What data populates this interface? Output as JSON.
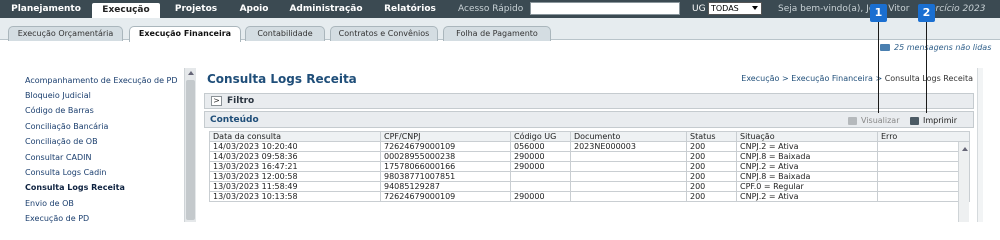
{
  "top_nav": {
    "tabs": [
      {
        "label": "Planejamento"
      },
      {
        "label": "Execução"
      },
      {
        "label": "Projetos"
      },
      {
        "label": "Apoio"
      },
      {
        "label": "Administração"
      },
      {
        "label": "Relatórios"
      }
    ],
    "acesso_rapido_label": "Acesso Rápido",
    "acesso_rapido_value": "",
    "ug_label": "UG",
    "ug_value": "TODAS",
    "welcome": "Seja bem-vindo(a), Joao Vitor",
    "exercicio": "Exercício 2023"
  },
  "sub_nav": {
    "tabs": [
      {
        "label": "Execução Orçamentária"
      },
      {
        "label": "Execução Financeira"
      },
      {
        "label": "Contabilidade"
      },
      {
        "label": "Contratos e Convênios"
      },
      {
        "label": "Folha de Pagamento"
      }
    ],
    "messages": "25 mensagens não lidas"
  },
  "sidebar": {
    "items": [
      {
        "label": "Acompanhamento de Execução de PD"
      },
      {
        "label": "Bloqueio Judicial"
      },
      {
        "label": "Código de Barras"
      },
      {
        "label": "Conciliação Bancária"
      },
      {
        "label": "Conciliação de OB"
      },
      {
        "label": "Consultar CADIN"
      },
      {
        "label": "Consulta Logs Cadin"
      },
      {
        "label": "Consulta Logs Receita"
      },
      {
        "label": "Envio de OB"
      },
      {
        "label": "Execução de PD"
      }
    ]
  },
  "main": {
    "title": "Consulta Logs Receita",
    "breadcrumb": {
      "first": "Execução",
      "sep1": ">",
      "second": "Execução Financeira",
      "sep2": ">",
      "current": "Consulta Logs Receita"
    },
    "filtro_label": "Filtro",
    "filtro_toggle": ">",
    "conteudo_label": "Conteúdo",
    "visualizar_label": "Visualizar",
    "imprimir_label": "Imprimir"
  },
  "table": {
    "columns": [
      "Data da consulta",
      "CPF/CNPJ",
      "Código UG",
      "Documento",
      "Status",
      "Situação",
      "Erro"
    ],
    "rows": [
      [
        "14/03/2023 10:20:40",
        "72624679000109",
        "056000",
        "2023NE000003",
        "200",
        "CNPJ.2 = Ativa",
        ""
      ],
      [
        "14/03/2023 09:58:36",
        "00028955000238",
        "290000",
        "",
        "200",
        "CNPJ.8 = Baixada",
        ""
      ],
      [
        "13/03/2023 16:47:21",
        "17578066000166",
        "290000",
        "",
        "200",
        "CNPJ.2 = Ativa",
        ""
      ],
      [
        "13/03/2023 12:00:58",
        "98038771007851",
        "",
        "",
        "200",
        "CNPJ.8 = Baixada",
        ""
      ],
      [
        "13/03/2023 11:58:49",
        "94085129287",
        "",
        "",
        "200",
        "CPF.0 = Regular",
        ""
      ],
      [
        "13/03/2023 10:13:58",
        "72624679000109",
        "290000",
        "",
        "200",
        "CNPJ.2 = Ativa",
        ""
      ]
    ]
  },
  "callouts": [
    {
      "label": "1"
    },
    {
      "label": "2"
    }
  ]
}
